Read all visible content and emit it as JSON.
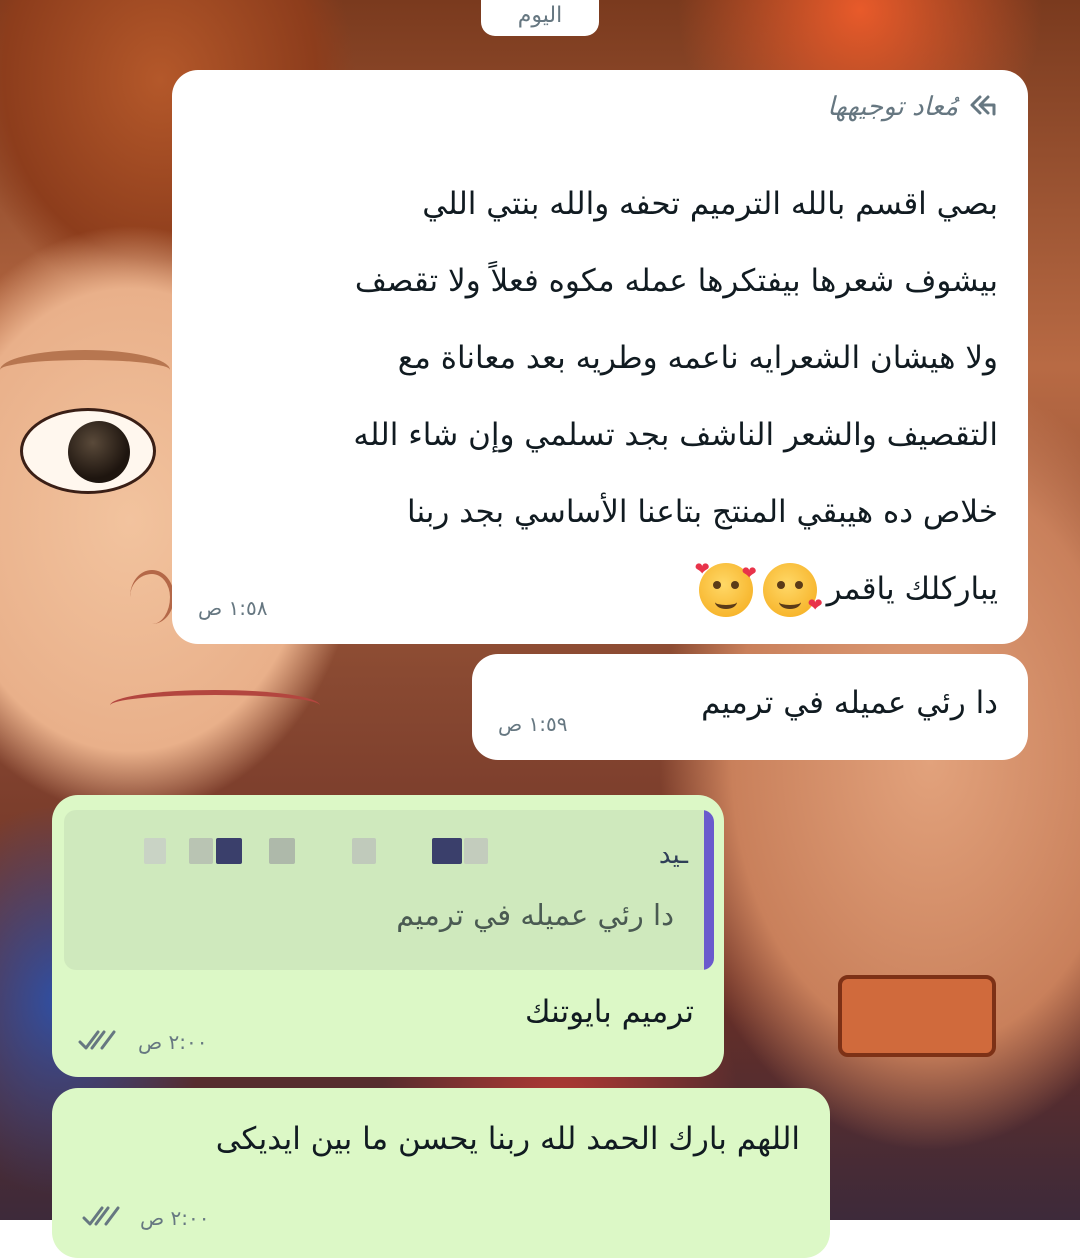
{
  "chat": {
    "top_date_label": "اليوم",
    "messages": [
      {
        "direction": "in",
        "forwarded_label": "مُعاد توجيهها",
        "lines": [
          "بصي اقسم بالله الترميم تحفه والله بنتي اللي",
          "بيشوف شعرها بيفتكرها عمله مكوه فعلاً ولا تقصف",
          "ولا هيشان الشعرايه ناعمه وطريه بعد معاناة مع",
          "التقصيف والشعر الناشف بجد تسلمي وإن شاء الله",
          "خلاص ده هيبقي المنتج بتاعنا الأساسي بجد ربنا",
          "يباركلك ياقمر"
        ],
        "emoji_icons": [
          "kissing-face-with-heart-icon",
          "smiling-face-with-hearts-icon"
        ],
        "time": "١:٥٨ ص"
      },
      {
        "direction": "in",
        "text": "دا رئي عميله في ترميم",
        "time": "١:٥٩ ص"
      },
      {
        "direction": "out",
        "quoted_sender": "ـيد",
        "quoted_text": "دا رئي عميله في ترميم",
        "text": "ترميم بايوتنك",
        "time": "٢:٠٠ ص",
        "status_icon": "double-check-icon"
      },
      {
        "direction": "out",
        "text": "اللهم بارك الحمد لله ربنا يحسن ما بين ايديكى",
        "time": "٢:٠٠ ص",
        "status_icon": "double-check-icon"
      }
    ]
  },
  "colors": {
    "incoming_bubble": "#ffffff",
    "outgoing_bubble": "#dcf8c6",
    "quote_bar": "#6a5acd",
    "read_check": "#667781",
    "meta_text": "#667781"
  }
}
